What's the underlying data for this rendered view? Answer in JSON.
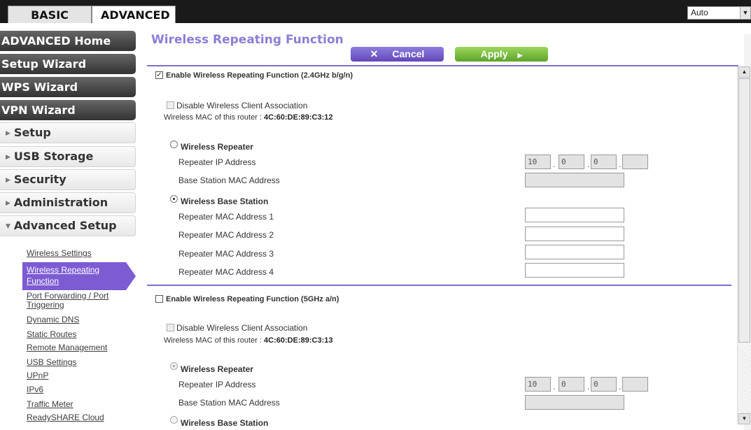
{
  "tabs": {
    "basic": "BASIC",
    "advanced": "ADVANCED"
  },
  "language": {
    "selected": "Auto"
  },
  "sidebar": {
    "dark_items": [
      "ADVANCED Home",
      "Setup Wizard",
      "WPS Wizard",
      "VPN Wizard"
    ],
    "light_items": [
      "Setup",
      "USB Storage",
      "Security",
      "Administration",
      "Advanced Setup"
    ],
    "sub_items": [
      "Wireless Settings",
      "Wireless Repeating Function",
      "Port Forwarding / Port Triggering",
      "Dynamic DNS",
      "Static Routes",
      "Remote Management",
      "USB Settings",
      "UPnP",
      "IPv6",
      "Traffic Meter",
      "ReadySHARE Cloud"
    ]
  },
  "page": {
    "title": "Wireless Repeating Function",
    "cancel_label": "Cancel",
    "apply_label": "Apply"
  },
  "section24": {
    "enable_label": "Enable Wireless Repeating Function (2.4GHz b/g/n)",
    "enable_checked": true,
    "disable_assoc_label": "Disable Wireless Client Association",
    "mac_prefix": "Wireless MAC of this router : ",
    "mac": "4C:60:DE:89:C3:12",
    "repeater_label": "Wireless Repeater",
    "repeater_ip_label": "Repeater IP Address",
    "ip": [
      "10",
      "0",
      "0",
      ""
    ],
    "base_mac_label": "Base Station MAC Address",
    "base_station_label": "Wireless Base Station",
    "rep_mac_labels": [
      "Repeater MAC Address 1",
      "Repeater MAC Address 2",
      "Repeater MAC Address 3",
      "Repeater MAC Address 4"
    ]
  },
  "section5": {
    "enable_label": "Enable Wireless Repeating Function (5GHz a/n)",
    "enable_checked": false,
    "disable_assoc_label": "Disable Wireless Client Association",
    "mac_prefix": "Wireless MAC of this router : ",
    "mac": "4C:60:DE:89:C3:13",
    "repeater_label": "Wireless Repeater",
    "repeater_ip_label": "Repeater IP Address",
    "ip": [
      "10",
      "0",
      "0",
      ""
    ],
    "base_mac_label": "Base Station MAC Address",
    "base_station_label": "Wireless Base Station"
  },
  "colors": {
    "accent": "#7c5bd3",
    "apply": "#6bb033",
    "title": "#8b7ed6"
  }
}
